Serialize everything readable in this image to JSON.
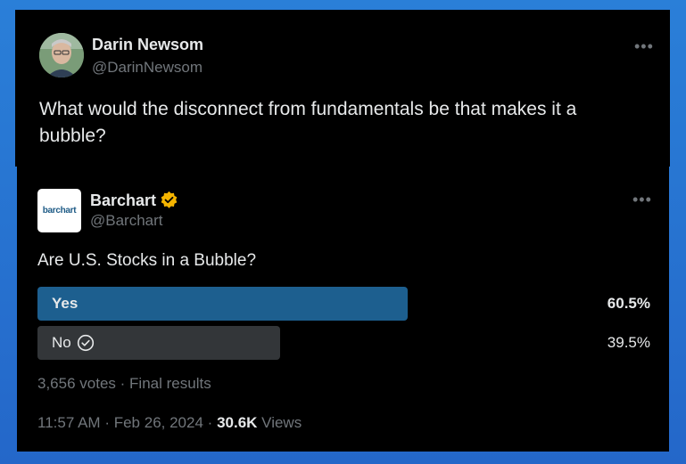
{
  "tweet": {
    "author_name": "Darin Newsom",
    "author_handle": "@DarinNewsom",
    "text": "What would the disconnect from fundamentals be that makes it a bubble?",
    "more_icon": "more-horizontal-icon"
  },
  "quoted": {
    "author_name": "Barchart",
    "author_handle": "@Barchart",
    "logo_text": "barchart",
    "verified_color": "#f4b400",
    "question": "Are U.S. Stocks in a Bubble?",
    "poll": {
      "options": [
        {
          "label": "Yes",
          "percent_text": "60.5%",
          "percent": 60.5,
          "winner": true
        },
        {
          "label": "No",
          "percent_text": "39.5%",
          "percent": 39.5,
          "winner": false,
          "selected_by_viewer": true
        }
      ],
      "votes": "3,656 votes",
      "status": "Final results",
      "separator": "·"
    },
    "time": "11:57 AM",
    "date": "Feb 26, 2024",
    "views_count": "30.6K",
    "views_label": "Views"
  }
}
